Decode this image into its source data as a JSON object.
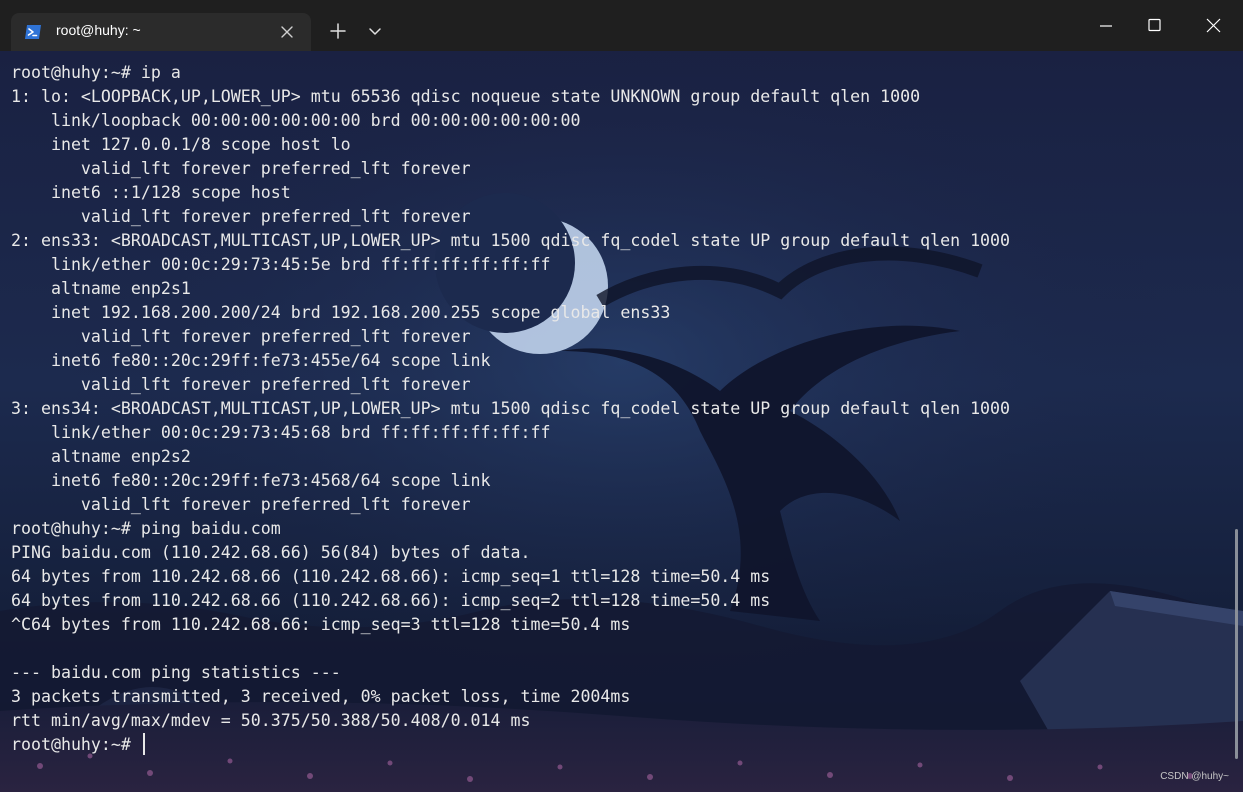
{
  "tab": {
    "title": "root@huhy: ~"
  },
  "icons": {
    "tab_icon": "powershell-terminal-icon",
    "tab_close": "close-icon",
    "new_tab": "plus-icon",
    "dropdown": "chevron-down-icon",
    "minimize": "minimize-icon",
    "maximize": "maximize-icon",
    "close": "close-icon"
  },
  "colors": {
    "titlebar": "#1f1f1f",
    "tab_active": "#2b2b2b",
    "terminal_text": "#e8e8e8",
    "tab_icon": "#2f73d6"
  },
  "terminal": {
    "lines": [
      "root@huhy:~# ip a",
      "1: lo: <LOOPBACK,UP,LOWER_UP> mtu 65536 qdisc noqueue state UNKNOWN group default qlen 1000",
      "    link/loopback 00:00:00:00:00:00 brd 00:00:00:00:00:00",
      "    inet 127.0.0.1/8 scope host lo",
      "       valid_lft forever preferred_lft forever",
      "    inet6 ::1/128 scope host",
      "       valid_lft forever preferred_lft forever",
      "2: ens33: <BROADCAST,MULTICAST,UP,LOWER_UP> mtu 1500 qdisc fq_codel state UP group default qlen 1000",
      "    link/ether 00:0c:29:73:45:5e brd ff:ff:ff:ff:ff:ff",
      "    altname enp2s1",
      "    inet 192.168.200.200/24 brd 192.168.200.255 scope global ens33",
      "       valid_lft forever preferred_lft forever",
      "    inet6 fe80::20c:29ff:fe73:455e/64 scope link",
      "       valid_lft forever preferred_lft forever",
      "3: ens34: <BROADCAST,MULTICAST,UP,LOWER_UP> mtu 1500 qdisc fq_codel state UP group default qlen 1000",
      "    link/ether 00:0c:29:73:45:68 brd ff:ff:ff:ff:ff:ff",
      "    altname enp2s2",
      "    inet6 fe80::20c:29ff:fe73:4568/64 scope link",
      "       valid_lft forever preferred_lft forever",
      "root@huhy:~# ping baidu.com",
      "PING baidu.com (110.242.68.66) 56(84) bytes of data.",
      "64 bytes from 110.242.68.66 (110.242.68.66): icmp_seq=1 ttl=128 time=50.4 ms",
      "64 bytes from 110.242.68.66 (110.242.68.66): icmp_seq=2 ttl=128 time=50.4 ms",
      "^C64 bytes from 110.242.68.66: icmp_seq=3 ttl=128 time=50.4 ms",
      "",
      "--- baidu.com ping statistics ---",
      "3 packets transmitted, 3 received, 0% packet loss, time 2004ms",
      "rtt min/avg/max/mdev = 50.375/50.388/50.408/0.014 ms"
    ],
    "prompt": "root@huhy:~# "
  },
  "watermark": "CSDN @huhy~"
}
